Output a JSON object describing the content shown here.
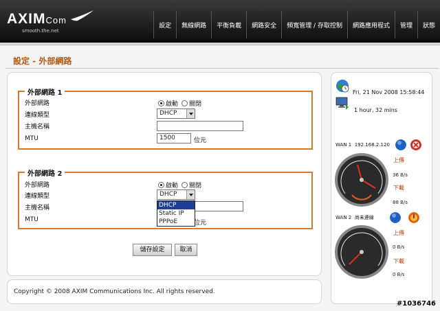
{
  "header": {
    "logo": "AXIM",
    "logo_suffix": "Com",
    "tagline": "smooth.the.net",
    "nav": [
      "設定",
      "無線網路",
      "平衡負載",
      "網路安全",
      "頻寬管理 / 存取控制",
      "網路應用程式",
      "管理",
      "狀態"
    ]
  },
  "page_title": "設定 - 外部網路",
  "wan1": {
    "legend": "外部網路 1",
    "enable_label": "外部網路",
    "on_label": "啟動",
    "off_label": "關閉",
    "enabled": true,
    "conn_type_label": "連線類型",
    "conn_type": "DHCP",
    "hostname_label": "主機名稱",
    "hostname": "",
    "mtu_label": "MTU",
    "mtu": "1500",
    "mtu_unit": "位元"
  },
  "wan2": {
    "legend": "外部網路 2",
    "enable_label": "外部網路",
    "on_label": "啟動",
    "off_label": "關閉",
    "enabled": true,
    "conn_type_label": "連線類型",
    "conn_type": "DHCP",
    "hostname_label": "主機名稱",
    "mtu_label": "MTU",
    "mtu_unit": "位元",
    "dropdown_options": [
      "DHCP",
      "Static IP",
      "PPPoE"
    ]
  },
  "buttons": {
    "save": "儲存設定",
    "cancel": "取消"
  },
  "footer": "Copyright © 2008 AXIM Communications Inc. All rights reserved.",
  "status": {
    "datetime": "Fri, 21 Nov 2008 15:58:44",
    "uptime": "1 hour, 32 mins",
    "wan1_label": "WAN 1",
    "wan1_ip": "192.168.2.120",
    "wan1_up_label": "上傳",
    "wan1_up": "36 B/s",
    "wan1_down_label": "下載",
    "wan1_down": "88 B/s",
    "wan2_label": "WAN 2",
    "wan2_ip": "尚未連線",
    "wan2_up_label": "上傳",
    "wan2_up": "0 B/s",
    "wan2_down_label": "下載",
    "wan2_down": "0 B/s"
  },
  "watermark": "#1036746",
  "colors": {
    "accent": "#d57a2a",
    "title": "#b05a12"
  }
}
